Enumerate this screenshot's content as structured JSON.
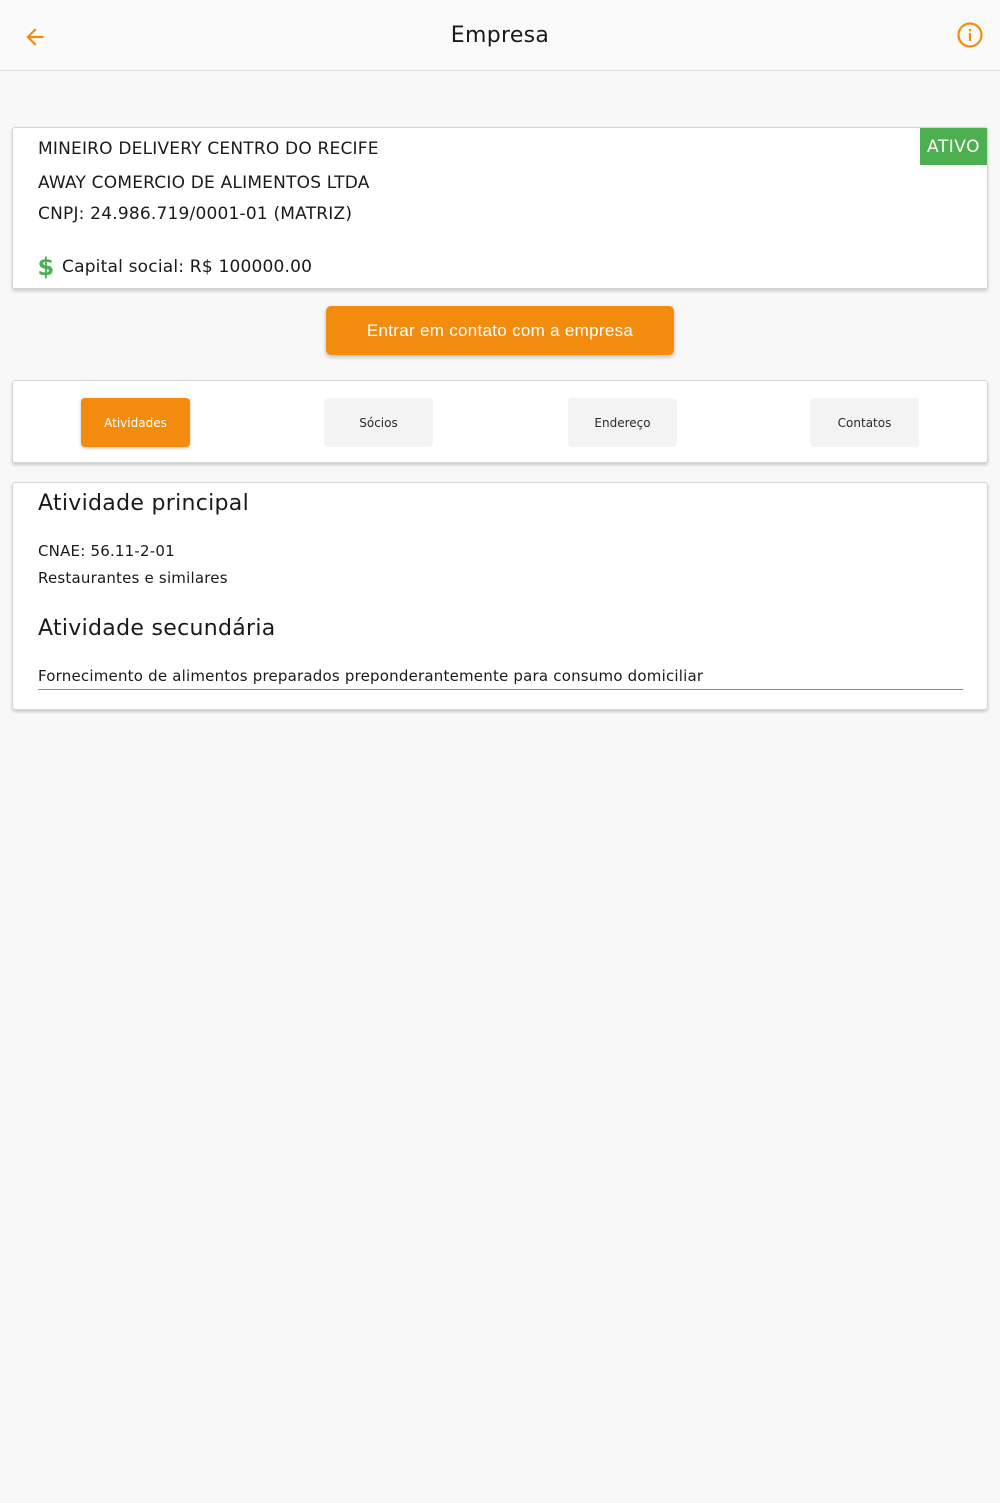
{
  "header": {
    "title": "Empresa",
    "back_icon": "arrow-left-icon",
    "info_icon": "info-circle-icon",
    "accent_color": "#f28c0f"
  },
  "company": {
    "trade_name": "MINEIRO DELIVERY CENTRO DO RECIFE",
    "legal_name": "AWAY COMERCIO DE ALIMENTOS LTDA",
    "cnpj": "CNPJ: 24.986.719/0001-01 (MATRIZ)",
    "capital_social": "Capital social: R$ 100000.00",
    "capital_icon": "dollar-icon",
    "status": "ATIVO",
    "status_color": "#4caf50"
  },
  "contact_button": {
    "label": "Entrar em contato com a empresa"
  },
  "tabs": [
    {
      "label": "Atividades",
      "active": true
    },
    {
      "label": "Sócios",
      "active": false
    },
    {
      "label": "Endereço",
      "active": false
    },
    {
      "label": "Contatos",
      "active": false
    }
  ],
  "activities": {
    "main_title": "Atividade principal",
    "main_cnae": "CNAE: 56.11-2-01",
    "main_description": "Restaurantes e similares",
    "secondary_title": "Atividade secundária",
    "secondary_items": [
      "Fornecimento de alimentos preparados preponderantemente para consumo domiciliar"
    ]
  }
}
